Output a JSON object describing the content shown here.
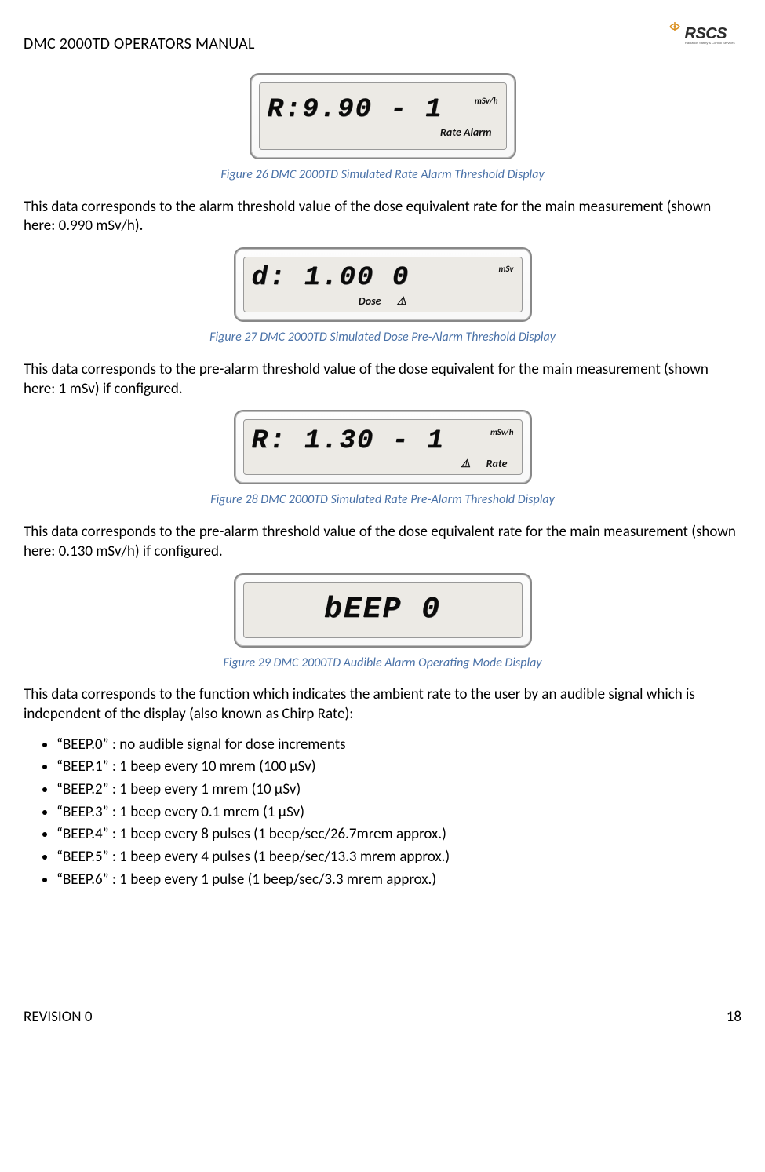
{
  "header": {
    "title": "DMC 2000TD OPERATORS MANUAL",
    "logo_text_main": "RSCS",
    "logo_text_sub": "Radiation Safety & Control Services"
  },
  "fig26": {
    "seg": "R:9.90 - 1",
    "unit": "mSv/h",
    "sub": "Rate Alarm",
    "caption": "Figure 26 DMC 2000TD Simulated Rate Alarm Threshold Display"
  },
  "p1": "This data corresponds to the alarm threshold value of the dose equivalent rate for the main measurement (shown here: 0.990 mSv/h).",
  "fig27": {
    "seg": "d: 1.00   0",
    "unit": "mSv",
    "sub1": "Dose",
    "warn": "⚠",
    "caption": "Figure 27 DMC 2000TD Simulated Dose Pre-Alarm Threshold Display"
  },
  "p2": "This data corresponds to the pre-alarm threshold value of the dose equivalent for the main measurement (shown here: 1 mSv) if configured.",
  "fig28": {
    "seg": "R: 1.30 - 1",
    "unit": "mSv/h",
    "warn": "⚠",
    "sub2": "Rate",
    "caption": "Figure 28 DMC 2000TD Simulated Rate Pre-Alarm Threshold Display"
  },
  "p3": "This data corresponds to the pre-alarm threshold value of the dose equivalent rate for the main measurement (shown here: 0.130 mSv/h) if configured.",
  "fig29": {
    "seg": "bEEP  0",
    "caption": "Figure 29 DMC 2000TD Audible Alarm Operating Mode Display"
  },
  "p4": "This data corresponds to the function which indicates the ambient rate to the user by an audible signal which is independent of the display (also known as Chirp Rate):",
  "bullets": [
    "“BEEP.0” : no audible signal for dose increments",
    "“BEEP.1” : 1 beep every 10 mrem (100 µSv)",
    "“BEEP.2” : 1 beep every 1 mrem (10 µSv)",
    "“BEEP.3” : 1 beep every 0.1 mrem (1 µSv)",
    "“BEEP.4” : 1 beep every 8 pulses (1 beep/sec/26.7mrem approx.)",
    "“BEEP.5” : 1 beep every 4 pulses (1 beep/sec/13.3 mrem approx.)",
    "“BEEP.6” : 1 beep every 1 pulse (1 beep/sec/3.3 mrem approx.)"
  ],
  "footer": {
    "left": "REVISION 0",
    "right": "18"
  }
}
